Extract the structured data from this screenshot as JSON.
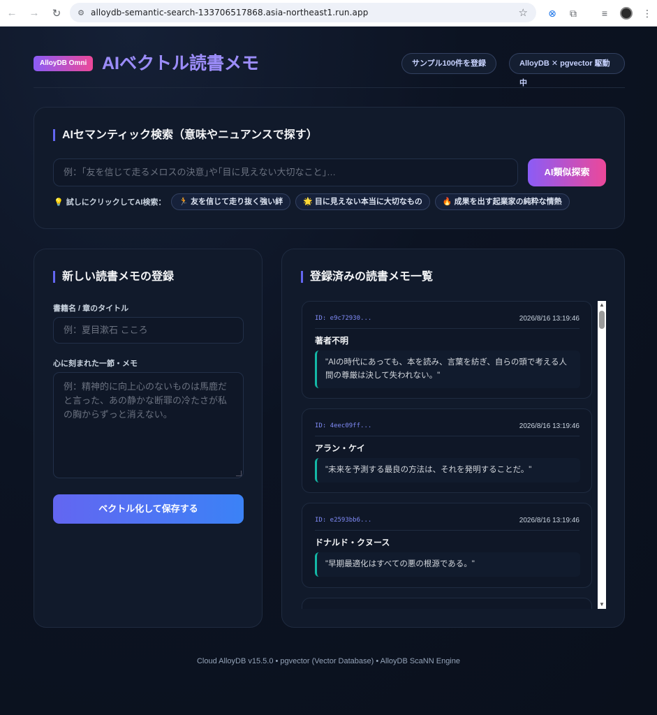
{
  "browser": {
    "url": "alloydb-semantic-search-133706517868.asia-northeast1.run.app"
  },
  "header": {
    "badge": "AlloyDB Omni",
    "title": "AIベクトル読書メモ",
    "register_sample_label": "サンプル100件を登録",
    "status_label": "AlloyDB ✕ pgvector 駆動中"
  },
  "search": {
    "section_title": "AIセマンティック検索（意味やニュアンスで探す）",
    "placeholder": "例：｢友を信じて走るメロスの決意｣や｢目に見えない大切なこと｣…",
    "button_label": "AI類似探索",
    "hint_label": "試しにクリックしてAI検索：",
    "suggestions": [
      {
        "icon": "🏃",
        "label": "友を信じて走り抜く強い絆"
      },
      {
        "icon": "🌟",
        "label": "目に見えない本当に大切なもの"
      },
      {
        "icon": "🔥",
        "label": "成果を出す起業家の純粋な情熱"
      }
    ]
  },
  "register": {
    "section_title": "新しい読書メモの登録",
    "title_label": "書籍名 / 章のタイトル",
    "title_placeholder": "例：夏目漱石 こころ",
    "memo_label": "心に刻まれた一節・メモ",
    "memo_placeholder": "例：精神的に向上心のないものは馬鹿だと言った、あの静かな断罪の冷たさが私の胸からずっと消えない。",
    "save_label": "ベクトル化して保存する"
  },
  "list": {
    "section_title": "登録済みの読書メモ一覧",
    "memos": [
      {
        "id": "ID: e9c72930...",
        "time": "2026/8/16 13:19:46",
        "author": "著者不明",
        "quote": "\"AIの時代にあっても、本を読み、言葉を紡ぎ、自らの頭で考える人間の尊厳は決して失われない。\""
      },
      {
        "id": "ID: 4eec09ff...",
        "time": "2026/8/16 13:19:46",
        "author": "アラン・ケイ",
        "quote": "\"未来を予測する最良の方法は、それを発明することだ。\""
      },
      {
        "id": "ID: e2593bb6...",
        "time": "2026/8/16 13:19:46",
        "author": "ドナルド・クヌース",
        "quote": "\"早期最適化はすべての悪の根源である。\""
      }
    ]
  },
  "footer": {
    "text": "Cloud AlloyDB v15.5.0 • pgvector (Vector Database) • AlloyDB ScaNN Engine"
  }
}
